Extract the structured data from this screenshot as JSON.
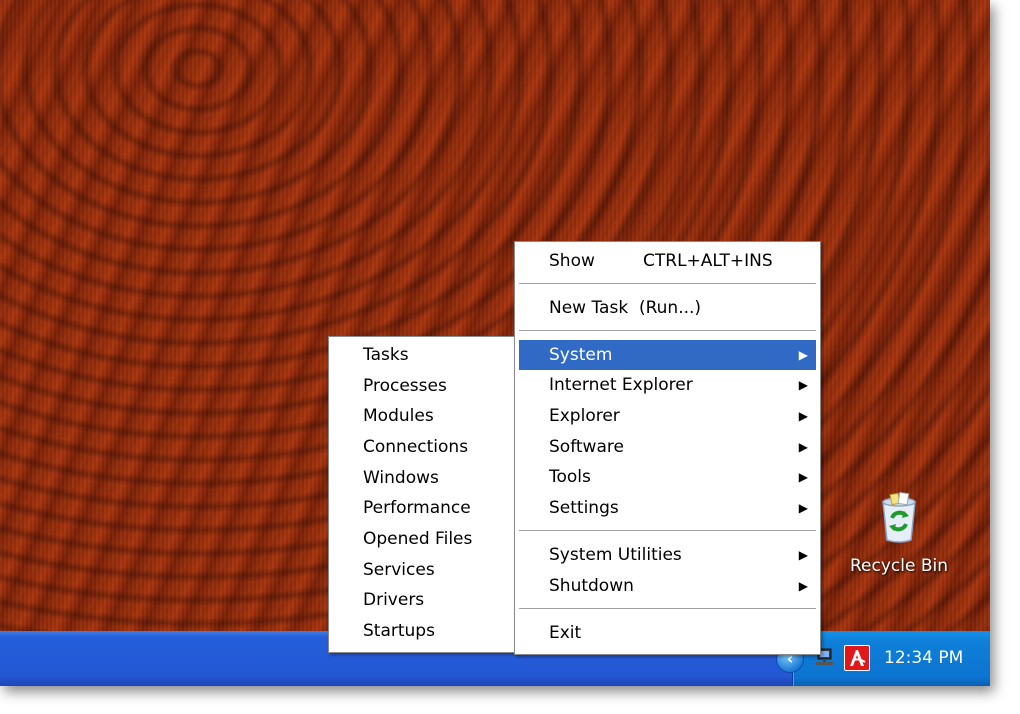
{
  "desktop": {
    "recycle_bin_label": "Recycle Bin",
    "icons": {
      "recycle_bin": "recycle-bin-icon"
    }
  },
  "taskbar": {
    "clock": "12:34 PM",
    "tray_icons": [
      "show-hidden-icons-chevron",
      "network-icon",
      "avira-icon"
    ],
    "colors": {
      "taskbar": "#245edb",
      "tray": "#0f7fd8"
    }
  },
  "main_menu": {
    "show_label": "Show",
    "show_shortcut": "CTRL+ALT+INS",
    "new_task_label": "New Task  (Run...)",
    "items": [
      {
        "label": "System",
        "submenu": true,
        "selected": true
      },
      {
        "label": "Internet Explorer",
        "submenu": true
      },
      {
        "label": "Explorer",
        "submenu": true
      },
      {
        "label": "Software",
        "submenu": true
      },
      {
        "label": "Tools",
        "submenu": true
      },
      {
        "label": "Settings",
        "submenu": true
      }
    ],
    "utilities": [
      {
        "label": "System Utilities",
        "submenu": true
      },
      {
        "label": "Shutdown",
        "submenu": true
      }
    ],
    "exit_label": "Exit",
    "arrow_glyph": "▶",
    "selection_color": "#316ac5"
  },
  "system_submenu": {
    "items": [
      "Tasks",
      "Processes",
      "Modules",
      "Connections",
      "Windows",
      "Performance",
      "Opened Files",
      "Services",
      "Drivers",
      "Startups"
    ]
  }
}
